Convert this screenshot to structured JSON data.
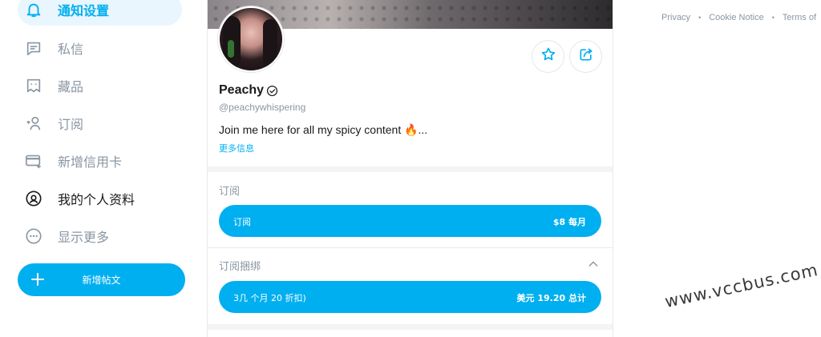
{
  "sidebar": {
    "items": [
      {
        "label": "通知设置",
        "icon": "bell-icon"
      },
      {
        "label": "私信",
        "icon": "message-icon"
      },
      {
        "label": "藏品",
        "icon": "collections-icon"
      },
      {
        "label": "订阅",
        "icon": "subscriptions-icon"
      },
      {
        "label": "新增信用卡",
        "icon": "add-card-icon"
      },
      {
        "label": "我的个人资料",
        "icon": "profile-icon"
      },
      {
        "label": "显示更多",
        "icon": "more-icon"
      }
    ],
    "new_post_label": "新增帖文"
  },
  "profile": {
    "name": "Peachy",
    "handle": "@peachywhispering",
    "bio": "Join me here for all my spicy content 🔥...",
    "more_info": "更多信息"
  },
  "subscription": {
    "title": "订阅",
    "button_left": "订阅",
    "button_right": "$8 每月"
  },
  "bundle": {
    "title": "订阅捆绑",
    "button_left": "3几 个月 20 折扣)",
    "button_right": "美元 19.20 总计"
  },
  "footer": {
    "privacy": "Privacy",
    "cookie": "Cookie Notice",
    "terms": "Terms of"
  },
  "watermark": "www.vccbus.com",
  "colors": {
    "accent": "#00aff0",
    "muted": "#8a96a3",
    "text": "#1a1a1a"
  }
}
